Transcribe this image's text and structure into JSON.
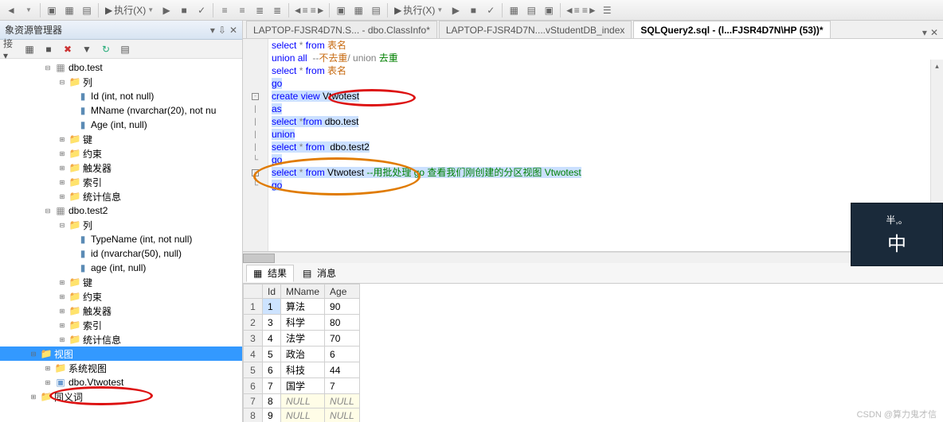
{
  "toolbar": {
    "exec_label": "执行(X)",
    "group2_exec": "执行(X)"
  },
  "sidebar": {
    "title": "象资源管理器",
    "connect_label": "接 ▾",
    "tree": {
      "test_table": "dbo.test",
      "cols_label": "列",
      "test_cols": [
        "Id (int, not null)",
        "MName (nvarchar(20), not nu",
        "Age (int, null)"
      ],
      "keys": "键",
      "constraints": "约束",
      "triggers": "触发器",
      "indexes": "索引",
      "stats": "统计信息",
      "test2_table": "dbo.test2",
      "test2_cols": [
        "TypeName (int, not null)",
        "id (nvarchar(50), null)",
        "age (int, null)"
      ],
      "views_label": "视图",
      "sysviews": "系统视图",
      "vtwotest": "dbo.Vtwotest",
      "synonyms": "同义词"
    }
  },
  "tabs": {
    "t1": "LAPTOP-FJSR4D7N.S... - dbo.ClassInfo*",
    "t2": "LAPTOP-FJSR4D7N....vStudentDB_index",
    "t3": "SQLQuery2.sql - (l...FJSR4D7N\\HP (53))*"
  },
  "code": {
    "l1_a": "select",
    "l1_b": " * ",
    "l1_c": "from",
    "l1_d": " 表名",
    "l2_a": "union all",
    "l2_b": "  --",
    "l2_c": "不去重",
    "l2_d": "/ union ",
    "l2_e": "去重",
    "l3_a": "select",
    "l3_b": " * ",
    "l3_c": "from",
    "l3_d": " 表名",
    "l4": "go",
    "l5_a": "create",
    "l5_b": " view ",
    "l5_c": "Vtwotest",
    "l6": "as",
    "l7_a": "select",
    "l7_b": " *",
    "l7_c": "from",
    "l7_d": " dbo.test",
    "l8": "union",
    "l9_a": "select",
    "l9_b": " * ",
    "l9_c": "from",
    "l9_d": "  dbo.test2",
    "l10": "go",
    "l11_a": "select",
    "l11_b": " * ",
    "l11_c": "from",
    "l11_d": " Vtwotest ",
    "l11_e": "--用批处理 go 查看我们刚创建的分区视图 Vtwotest",
    "l12": "go"
  },
  "results": {
    "tab_result": "结果",
    "tab_messages": "消息",
    "columns": [
      "",
      "Id",
      "MName",
      "Age"
    ],
    "rows": [
      [
        "1",
        "1",
        "算法",
        "90"
      ],
      [
        "2",
        "3",
        "科学",
        "80"
      ],
      [
        "3",
        "4",
        "法学",
        "70"
      ],
      [
        "4",
        "5",
        "政治",
        "6"
      ],
      [
        "5",
        "6",
        "科技",
        "44"
      ],
      [
        "6",
        "7",
        "国学",
        "7"
      ],
      [
        "7",
        "8",
        "NULL",
        "NULL"
      ],
      [
        "8",
        "9",
        "NULL",
        "NULL"
      ]
    ]
  },
  "watermark": "CSDN @算力鬼才信",
  "badge": {
    "top": "半,。",
    "bot": "中"
  }
}
